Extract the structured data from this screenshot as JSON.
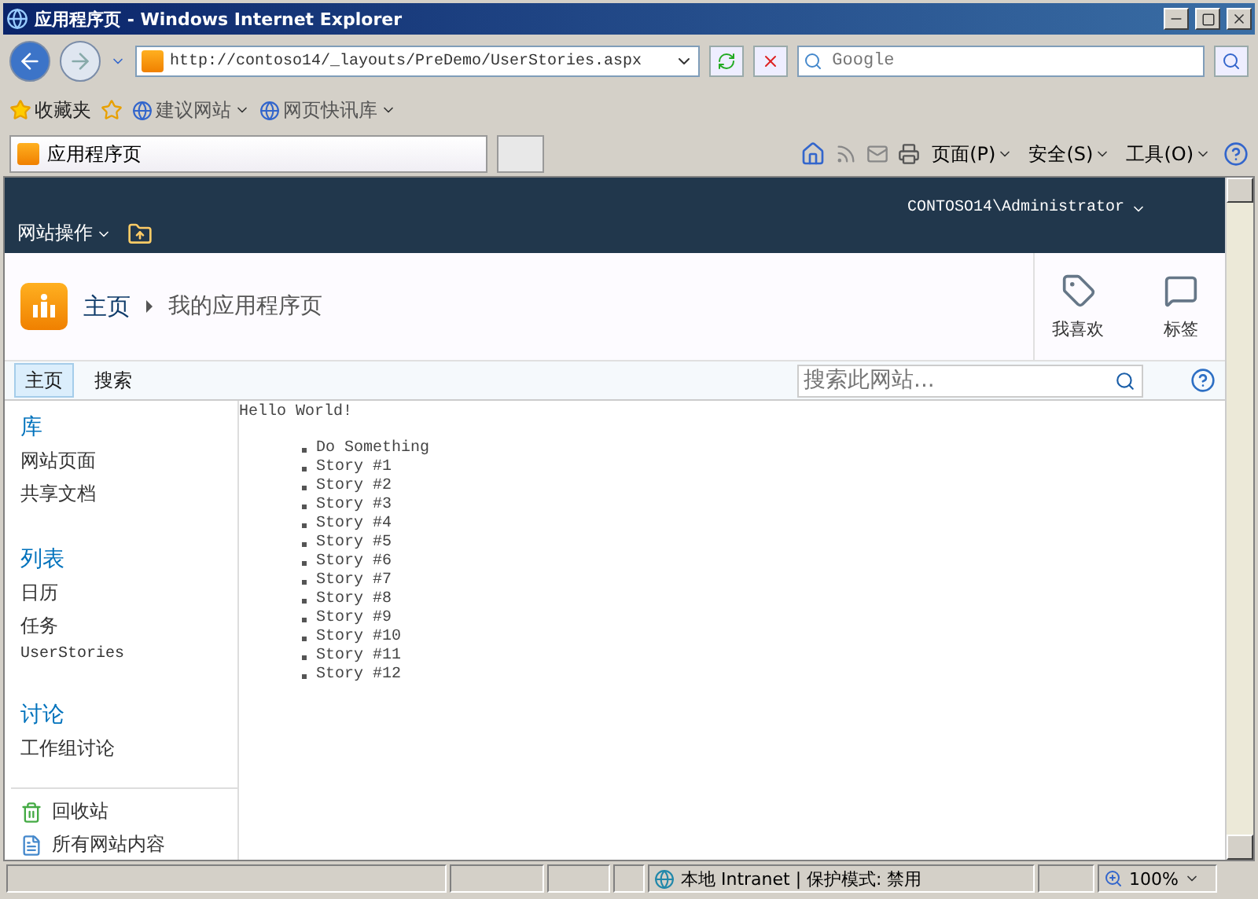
{
  "window": {
    "title": "应用程序页 - Windows Internet Explorer"
  },
  "address_bar": {
    "url": "http://contoso14/_layouts/PreDemo/UserStories.aspx",
    "search_placeholder": "Google"
  },
  "favorites_bar": {
    "label": "收藏夹",
    "links": [
      "建议网站",
      "网页快讯库"
    ]
  },
  "tabs": [
    {
      "label": "应用程序页",
      "selected": true
    }
  ],
  "command_bar": [
    "页面(P)",
    "安全(S)",
    "工具(O)"
  ],
  "site_header": {
    "site_actions": "网站操作",
    "user": "CONTOSO14\\Administrator"
  },
  "title_area": {
    "breadcrumb": [
      "主页",
      "我的应用程序页"
    ],
    "actions": [
      {
        "kind": "like",
        "label": "我喜欢"
      },
      {
        "kind": "tags",
        "label": "标签"
      }
    ]
  },
  "top_nav": [
    {
      "label": "主页",
      "selected": true
    },
    {
      "label": "搜索",
      "selected": false
    }
  ],
  "site_search": {
    "placeholder": "搜索此网站..."
  },
  "quick_launch": [
    {
      "heading": "库",
      "items": [
        "网站页面",
        "共享文档"
      ]
    },
    {
      "heading": "列表",
      "items": [
        "日历",
        "任务",
        "UserStories"
      ]
    },
    {
      "heading": "讨论",
      "items": [
        "工作组讨论"
      ]
    }
  ],
  "quick_launch_footer": [
    {
      "kind": "recycle",
      "label": "回收站"
    },
    {
      "kind": "content",
      "label": "所有网站内容"
    }
  ],
  "content": {
    "heading": "Hello World!",
    "items": [
      "Do Something",
      "Story #1",
      "Story #2",
      "Story #3",
      "Story #4",
      "Story #5",
      "Story #6",
      "Story #7",
      "Story #8",
      "Story #9",
      "Story #10",
      "Story #11",
      "Story #12"
    ]
  },
  "status_bar": {
    "zone": "本地 Intranet | 保护模式: 禁用",
    "zoom": "100%"
  }
}
